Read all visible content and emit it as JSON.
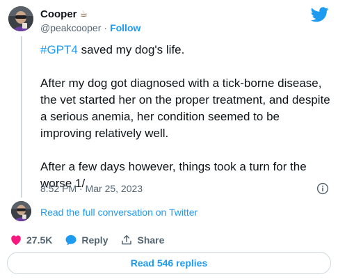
{
  "author": {
    "display_name": "Cooper",
    "name_emoji": "☕",
    "handle": "@peakcooper",
    "separator": "·",
    "follow_label": "Follow"
  },
  "brand": {
    "icon": "twitter-bird-icon",
    "color": "#1d9bf0"
  },
  "tweet": {
    "hashtag": "#GPT4",
    "line1_rest": " saved my dog's life.",
    "paragraph2": "After my dog got diagnosed with a tick-borne disease,  the vet started her on the proper treatment, and despite a serious anemia, her condition seemed to be improving relatively well.",
    "paragraph3": "After a few days however, things took a turn for the worse 1/",
    "timestamp": "8:52 PM · Mar 25, 2023"
  },
  "thread": {
    "full_conversation_label": "Read the full conversation on Twitter"
  },
  "actions": {
    "likes": {
      "icon": "heart-icon",
      "count": "27.5K",
      "color": "#f91880"
    },
    "reply": {
      "icon": "reply-bubble-icon",
      "label": "Reply",
      "color": "#1d9bf0"
    },
    "share": {
      "icon": "share-icon",
      "label": "Share"
    }
  },
  "read_replies_label": "Read 546 replies",
  "colors": {
    "text": "#0f1419",
    "muted": "#536471",
    "link": "#1d9bf0",
    "border": "#cfd9de"
  }
}
